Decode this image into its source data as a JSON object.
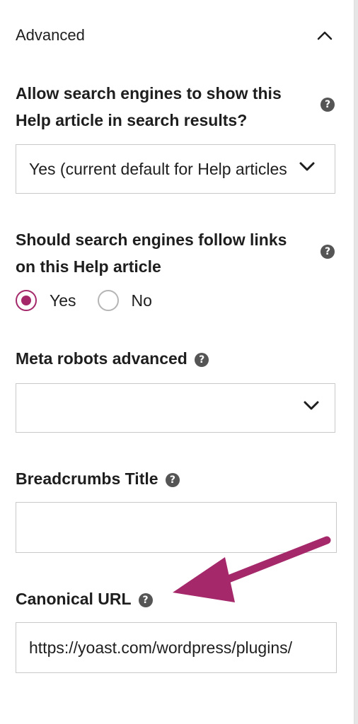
{
  "panel": {
    "title": "Advanced"
  },
  "search_visibility": {
    "label_line1": "Allow search engines to show this",
    "label_line2": "Help article in search results?",
    "selected": "Yes (current default for Help articles)"
  },
  "follow_links": {
    "label_line1": "Should search engines follow links",
    "label_line2": "on this Help article",
    "options": [
      {
        "label": "Yes",
        "checked": true
      },
      {
        "label": "No",
        "checked": false
      }
    ]
  },
  "meta_robots": {
    "label": "Meta robots advanced",
    "selected": ""
  },
  "breadcrumbs": {
    "label": "Breadcrumbs Title",
    "value": ""
  },
  "canonical": {
    "label": "Canonical URL",
    "value": "https://yoast.com/wordpress/plugins/"
  },
  "help_glyph": "?",
  "colors": {
    "accent": "#a4286a",
    "arrow": "#a4286a"
  }
}
